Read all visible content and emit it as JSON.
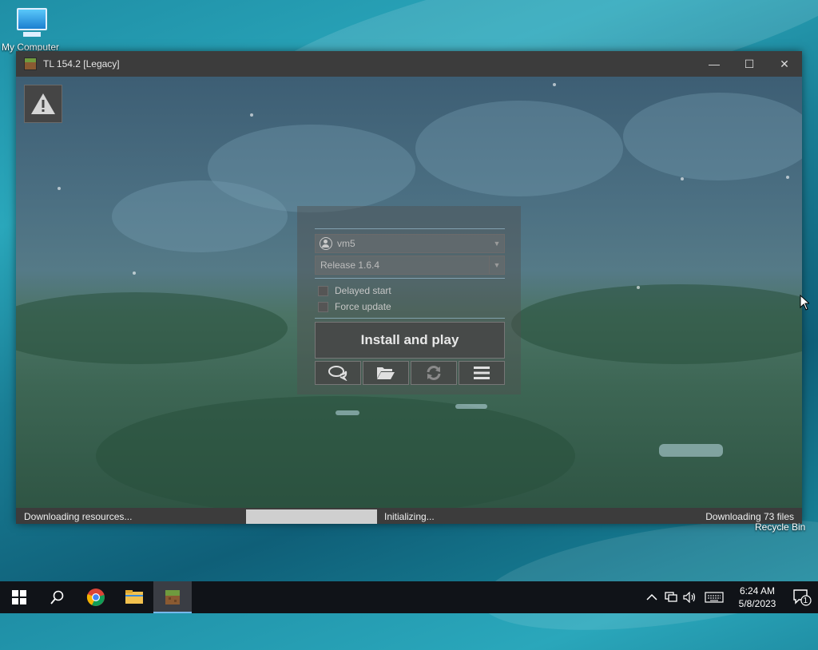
{
  "desktop": {
    "icons": [
      {
        "label": "My Computer"
      }
    ],
    "recycle_label": "Recycle Bin"
  },
  "window": {
    "title": "TL 154.2 [Legacy]",
    "buttons": {
      "minimize": "—",
      "maximize": "☐",
      "close": "✕"
    }
  },
  "launcher": {
    "account": "vm5",
    "version": "Release 1.6.4",
    "options": [
      {
        "label": "Delayed start",
        "checked": false
      },
      {
        "label": "Force update",
        "checked": false
      }
    ],
    "play_label": "Install and play",
    "tools": [
      "chat-icon",
      "folder-icon",
      "refresh-icon",
      "menu-icon"
    ]
  },
  "status": {
    "left": "Downloading resources...",
    "progress": 1.0,
    "middle": "Initializing...",
    "right": "Downloading 73 files"
  },
  "taskbar": {
    "apps": [
      "start-icon",
      "search-icon",
      "chrome-icon",
      "file-explorer-icon",
      "tlauncher-icon"
    ],
    "clock": {
      "time": "6:24 AM",
      "date": "5/8/2023"
    },
    "notification_count": "1"
  },
  "colors": {
    "accent": "#76b9ed",
    "window": "#3c3c3c",
    "progress": "#cfcfcf"
  }
}
